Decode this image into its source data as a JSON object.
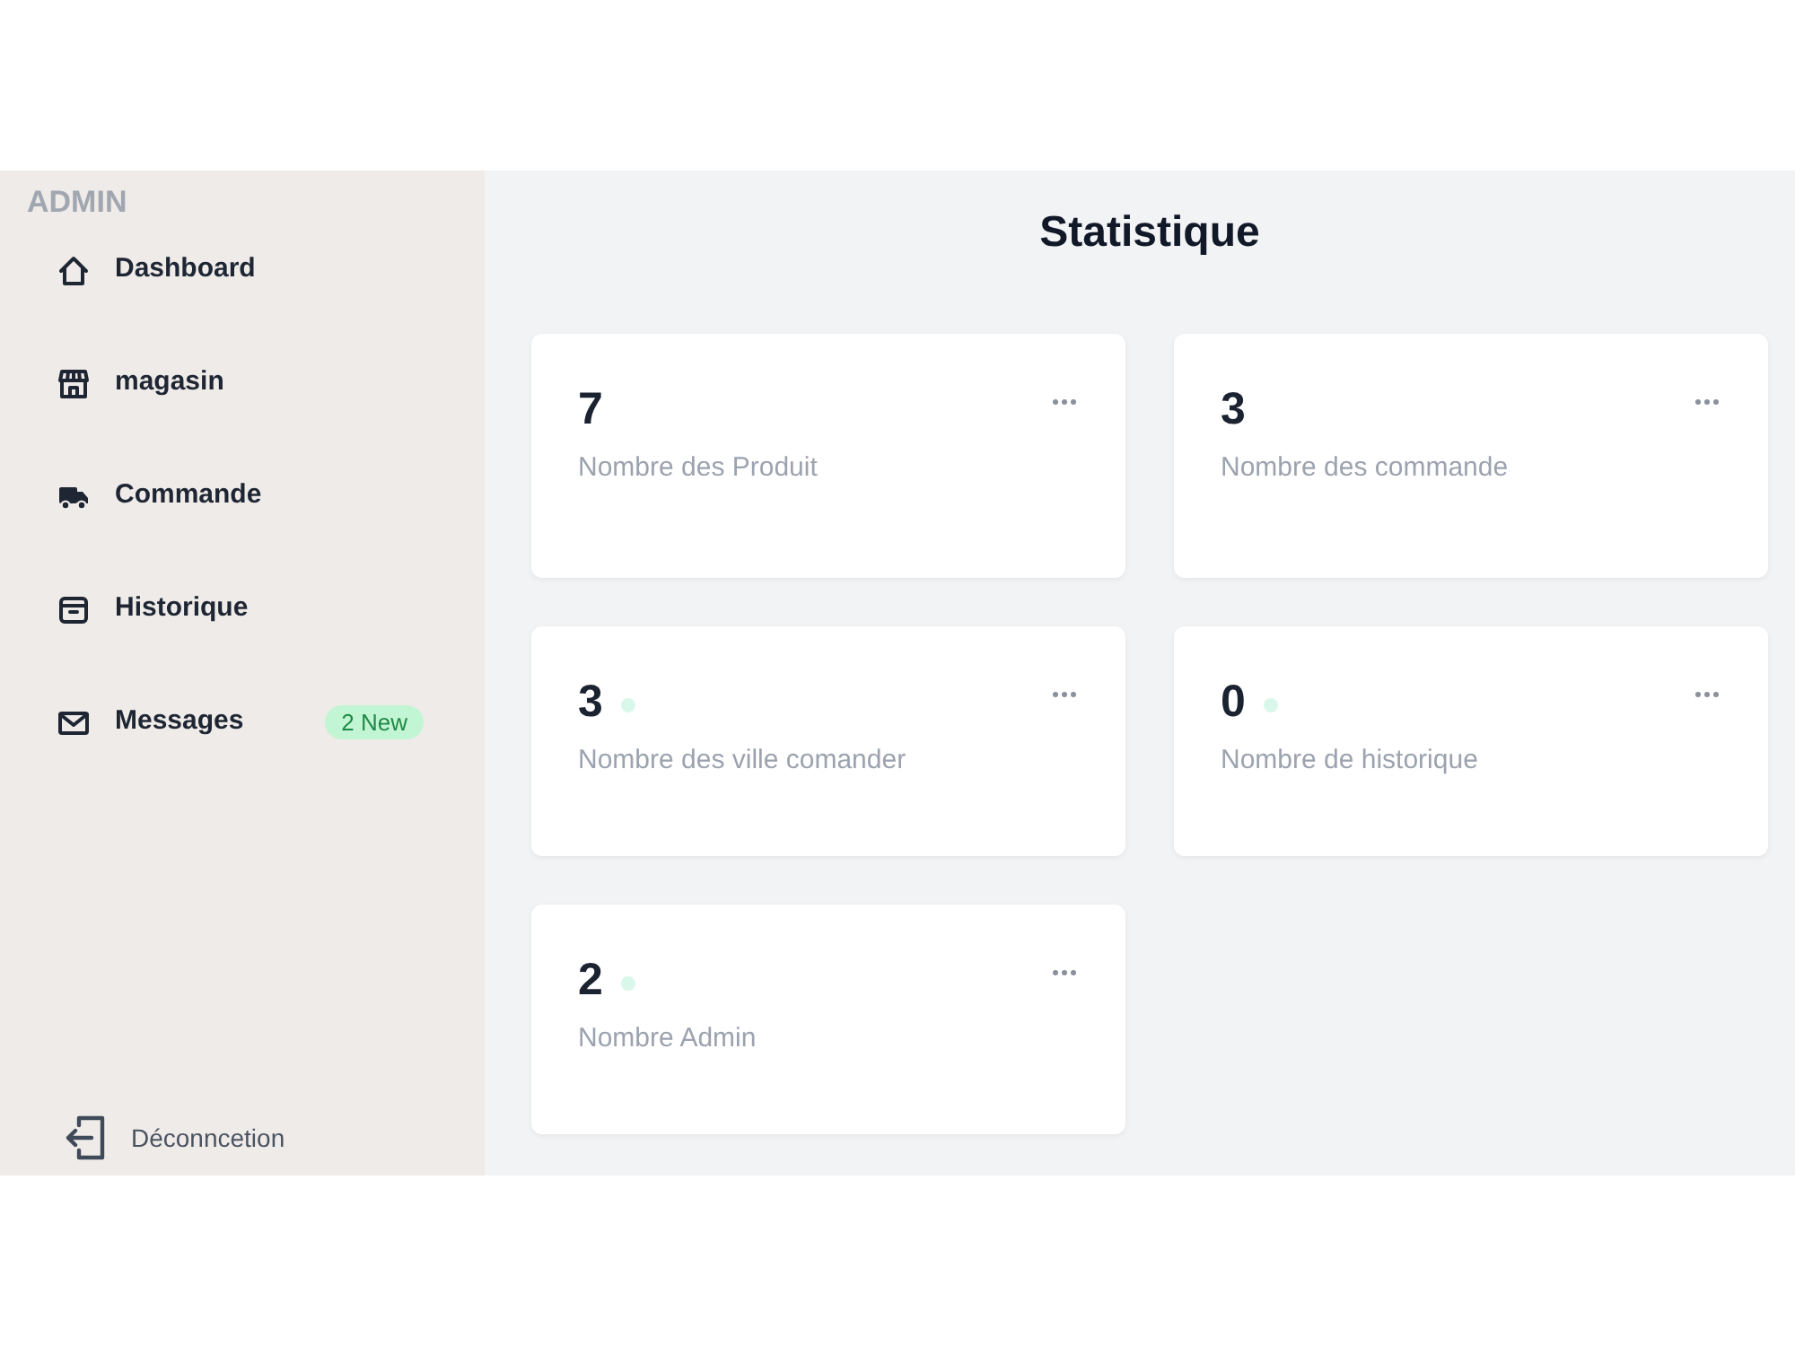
{
  "sidebar": {
    "title": "ADMIN",
    "items": [
      {
        "label": "Dashboard"
      },
      {
        "label": "magasin"
      },
      {
        "label": "Commande"
      },
      {
        "label": "Historique"
      },
      {
        "label": "Messages",
        "badge": "2 New"
      }
    ],
    "logout": {
      "label": "Déconncetion"
    }
  },
  "main": {
    "title": "Statistique",
    "cards": [
      {
        "value": "7",
        "label": "Nombre des Produit"
      },
      {
        "value": "3",
        "label": "Nombre des commande"
      },
      {
        "value": "3",
        "label": "Nombre des ville comander",
        "color": "#d9f7ea"
      },
      {
        "value": "0",
        "label": "Nombre de historique",
        "color": "#d9f7ea"
      },
      {
        "value": "2",
        "label": "Nombre Admin",
        "color": "#d9f7ea"
      }
    ]
  }
}
